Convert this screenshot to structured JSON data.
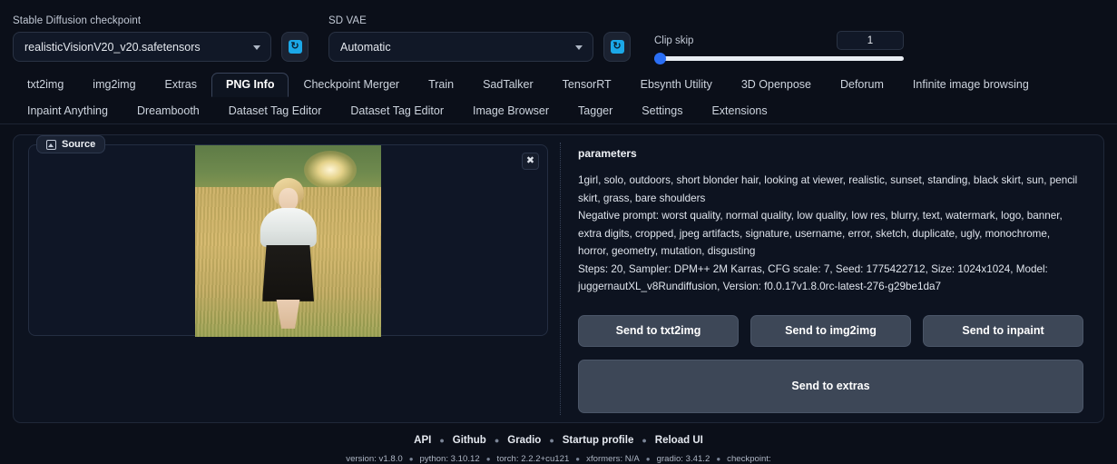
{
  "topbar": {
    "checkpoint": {
      "label": "Stable Diffusion checkpoint",
      "value": "realisticVisionV20_v20.safetensors",
      "refresh_icon": "refresh-icon"
    },
    "vae": {
      "label": "SD VAE",
      "value": "Automatic",
      "refresh_icon": "refresh-icon"
    },
    "clip_skip": {
      "label": "Clip skip",
      "value": "1",
      "min": 1,
      "max": 12,
      "fill_percent": 0
    }
  },
  "tabs": {
    "row1": [
      {
        "label": "txt2img",
        "active": false
      },
      {
        "label": "img2img",
        "active": false
      },
      {
        "label": "Extras",
        "active": false
      },
      {
        "label": "PNG Info",
        "active": true
      },
      {
        "label": "Checkpoint Merger",
        "active": false
      },
      {
        "label": "Train",
        "active": false
      },
      {
        "label": "SadTalker",
        "active": false
      },
      {
        "label": "TensorRT",
        "active": false
      },
      {
        "label": "Ebsynth Utility",
        "active": false
      },
      {
        "label": "3D Openpose",
        "active": false
      },
      {
        "label": "Deforum",
        "active": false
      },
      {
        "label": "Infinite image browsing",
        "active": false
      }
    ],
    "row2": [
      {
        "label": "Inpaint Anything",
        "active": false
      },
      {
        "label": "Dreambooth",
        "active": false
      },
      {
        "label": "Dataset Tag Editor",
        "active": false
      },
      {
        "label": "Dataset Tag Editor",
        "active": false
      },
      {
        "label": "Image Browser",
        "active": false
      },
      {
        "label": "Tagger",
        "active": false
      },
      {
        "label": "Settings",
        "active": false
      },
      {
        "label": "Extensions",
        "active": false
      }
    ]
  },
  "source_panel": {
    "tab_label": "Source",
    "tab_icon": "image-icon",
    "close_icon": "close-icon"
  },
  "parameters": {
    "title": "parameters",
    "prompt": "1girl, solo, outdoors, short blonder hair, looking at viewer, realistic, sunset, standing, black skirt, sun, pencil skirt, grass, bare shoulders",
    "negative_prompt": "Negative prompt: worst quality, normal quality, low quality, low res, blurry, text, watermark, logo, banner, extra digits, cropped, jpeg artifacts, signature, username, error, sketch, duplicate, ugly, monochrome, horror, geometry, mutation, disgusting",
    "settings": "Steps: 20, Sampler: DPM++ 2M Karras, CFG scale: 7, Seed: 1775422712, Size: 1024x1024, Model: juggernautXL_v8Rundiffusion, Version: f0.0.17v1.8.0rc-latest-276-g29be1da7"
  },
  "actions": {
    "send_txt2img": "Send to txt2img",
    "send_img2img": "Send to img2img",
    "send_inpaint": "Send to inpaint",
    "send_extras": "Send to extras"
  },
  "footer": {
    "links": [
      "API",
      "Github",
      "Gradio",
      "Startup profile",
      "Reload UI"
    ],
    "version_items": [
      "version: v1.8.0",
      "python: 3.10.12",
      "torch: 2.2.2+cu121",
      "xformers: N/A",
      "gradio: 3.41.2",
      "checkpoint:"
    ]
  },
  "colors": {
    "background": "#0b0f19",
    "panel": "#0d1320",
    "accent_blue": "#1ba8e8",
    "slider_blue": "#2a6ef5",
    "button": "#3d4757"
  }
}
